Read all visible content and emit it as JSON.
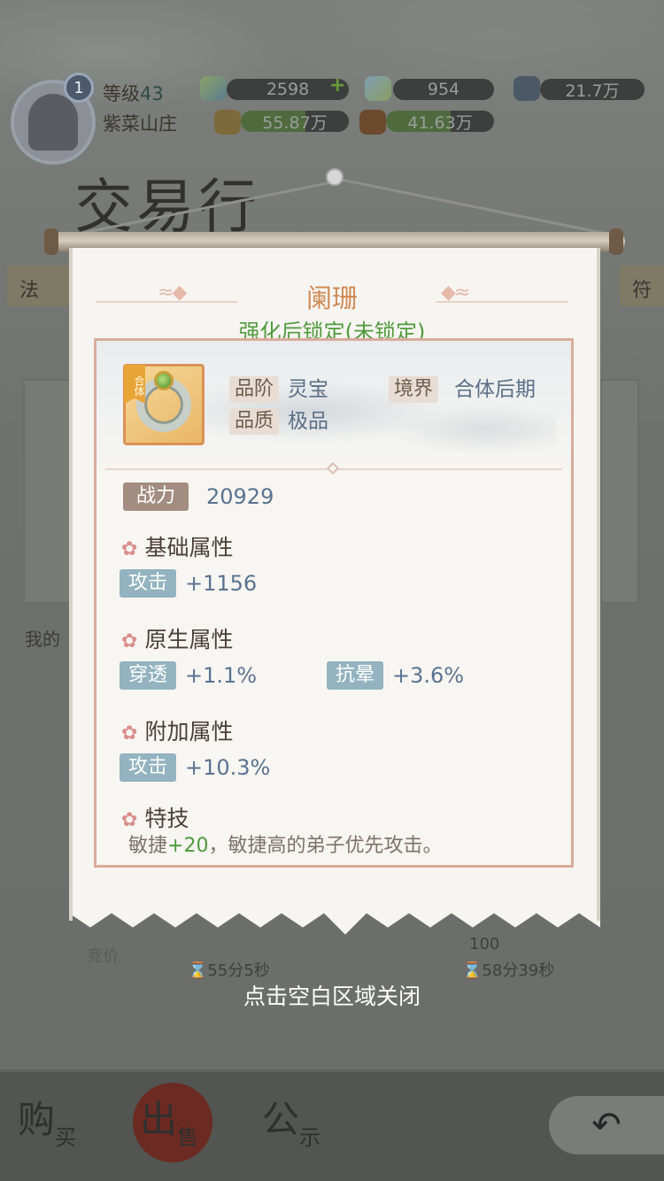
{
  "header": {
    "rank_badge": "1",
    "level_label": "等级",
    "level_value": "43",
    "sect_name": "紫菜山庄",
    "resources": [
      {
        "name": "spirit-stone",
        "value": "2598"
      },
      {
        "name": "crystal",
        "value": "954"
      },
      {
        "name": "ore",
        "value": "21.7万"
      },
      {
        "name": "gold",
        "value": "55.87万"
      },
      {
        "name": "wood",
        "value": "41.63万"
      }
    ],
    "add_symbol": "+"
  },
  "page_title": "交易行",
  "background": {
    "tab_left": "法",
    "tab_right": "符",
    "my_label": "我的",
    "bid_label": "竞价",
    "timer_left": "⌛55分5秒",
    "timer_right": "⌛58分39秒",
    "timer_right_top": "100"
  },
  "bottom_nav": [
    {
      "big": "购",
      "small": "买"
    },
    {
      "big": "出",
      "small": "售"
    },
    {
      "big": "公",
      "small": "示"
    }
  ],
  "back_icon": "↶",
  "item": {
    "name": "阑珊",
    "lock_status": "强化后锁定(未锁定)",
    "tier_tag": "合体",
    "grade_label": "品阶",
    "grade_value": "灵宝",
    "realm_label": "境界",
    "realm_value": "合体后期",
    "quality_label": "品质",
    "quality_value": "极品",
    "power_label": "战力",
    "power_value": "20929",
    "sections": {
      "base_title": "基础属性",
      "native_title": "原生属性",
      "extra_title": "附加属性",
      "skill_title": "特技"
    },
    "base_stats": [
      {
        "label": "攻击",
        "value": "+1156"
      }
    ],
    "native_stats": [
      {
        "label": "穿透",
        "value": "+1.1%"
      },
      {
        "label": "抗晕",
        "value": "+3.6%"
      }
    ],
    "extra_stats": [
      {
        "label": "攻击",
        "value": "+10.3%"
      }
    ],
    "skill": {
      "prefix": "敏捷",
      "bonus": "+20",
      "suffix": "，敏捷高的弟子优先攻击。"
    }
  },
  "close_hint": "点击空白区域关闭",
  "colors": {
    "item_name": "#d08a55",
    "lock_status": "#4f9a3c",
    "stat_value": "#5a7391",
    "stat_tag": "#92b3bf",
    "power_tag": "#a38c80"
  }
}
